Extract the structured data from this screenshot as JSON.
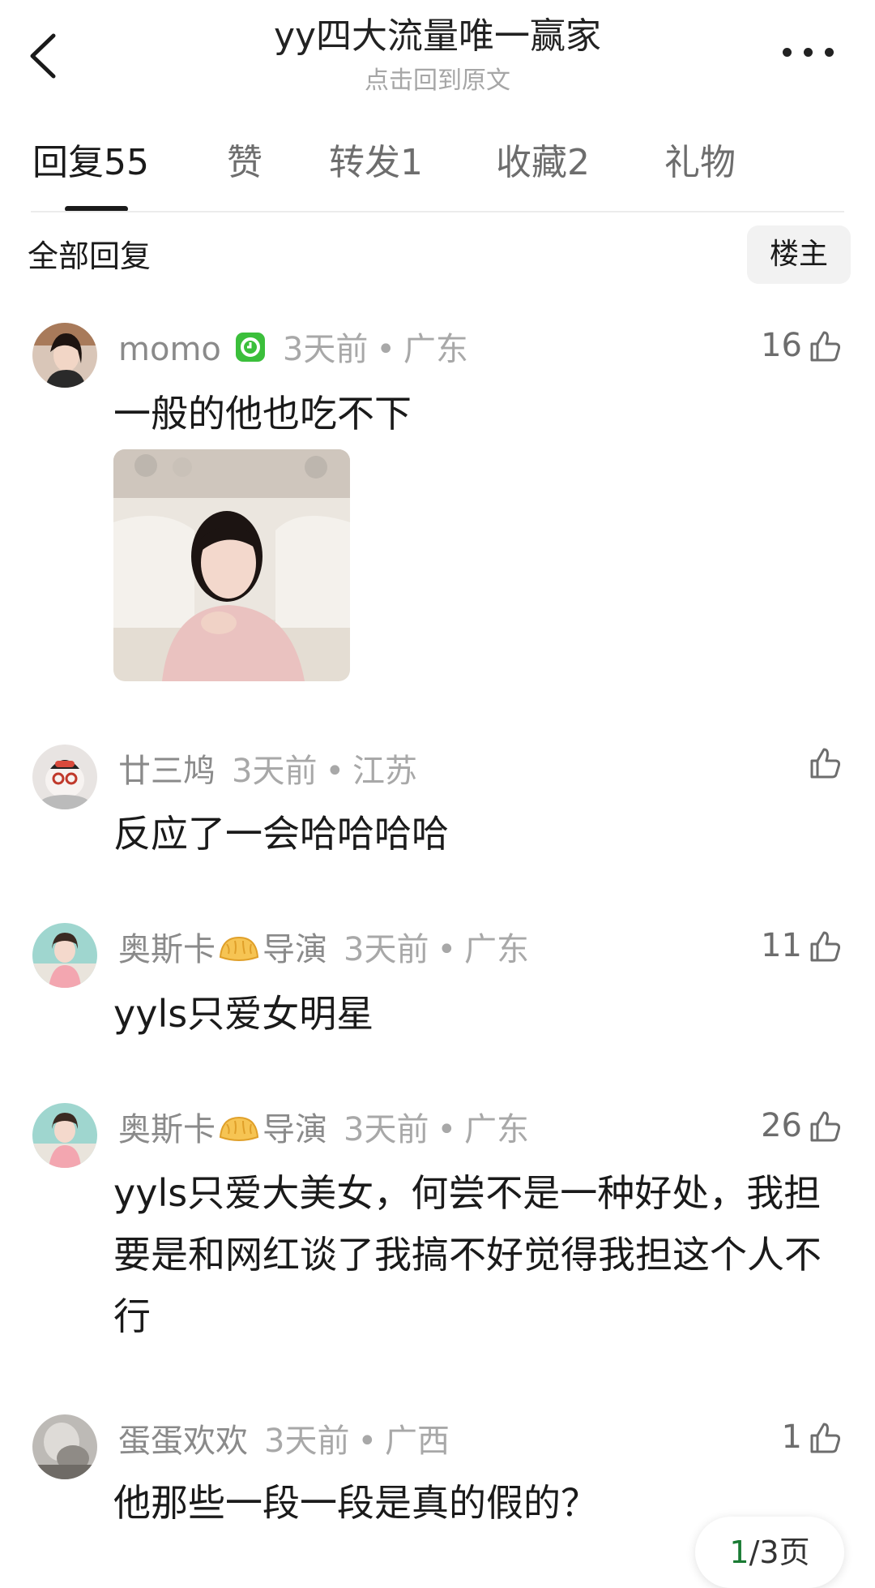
{
  "header": {
    "title": "yy四大流量唯一赢家",
    "subtitle": "点击回到原文"
  },
  "tabs": [
    {
      "label": "回复",
      "count": "55"
    },
    {
      "label": "赞",
      "count": ""
    },
    {
      "label": "转发",
      "count": "1"
    },
    {
      "label": "收藏",
      "count": "2"
    },
    {
      "label": "礼物",
      "count": ""
    }
  ],
  "filter": {
    "all_label": "全部回复",
    "op_label": "楼主"
  },
  "comments": [
    {
      "username": "momo",
      "time": "3天前",
      "dot": "•",
      "location": "广东",
      "likes": "16",
      "text": "一般的他也吃不下"
    },
    {
      "username": "廿三鸠",
      "time": "3天前",
      "dot": "•",
      "location": "江苏",
      "likes": "",
      "text": "反应了一会哈哈哈哈"
    },
    {
      "username": "奥斯卡",
      "title_badge": "导演",
      "time": "3天前",
      "dot": "•",
      "location": "广东",
      "likes": "11",
      "text": "yyls只爱女明星"
    },
    {
      "username": "奥斯卡",
      "title_badge": "导演",
      "time": "3天前",
      "dot": "•",
      "location": "广东",
      "likes": "26",
      "text": "yyls只爱大美女，何尝不是一种好处，我担要是和网红谈了我搞不好觉得我担这个人不行"
    },
    {
      "username": "蛋蛋欢欢",
      "time": "3天前",
      "dot": "•",
      "location": "广西",
      "likes": "1",
      "text": "他那些一段一段是真的假的？"
    }
  ],
  "pager": {
    "current": "1",
    "total_text": "/3页"
  },
  "colors": {
    "accent_green": "#1a7b34",
    "muted_text": "#a8a8a8",
    "badge_green": "#3bbf3b"
  }
}
